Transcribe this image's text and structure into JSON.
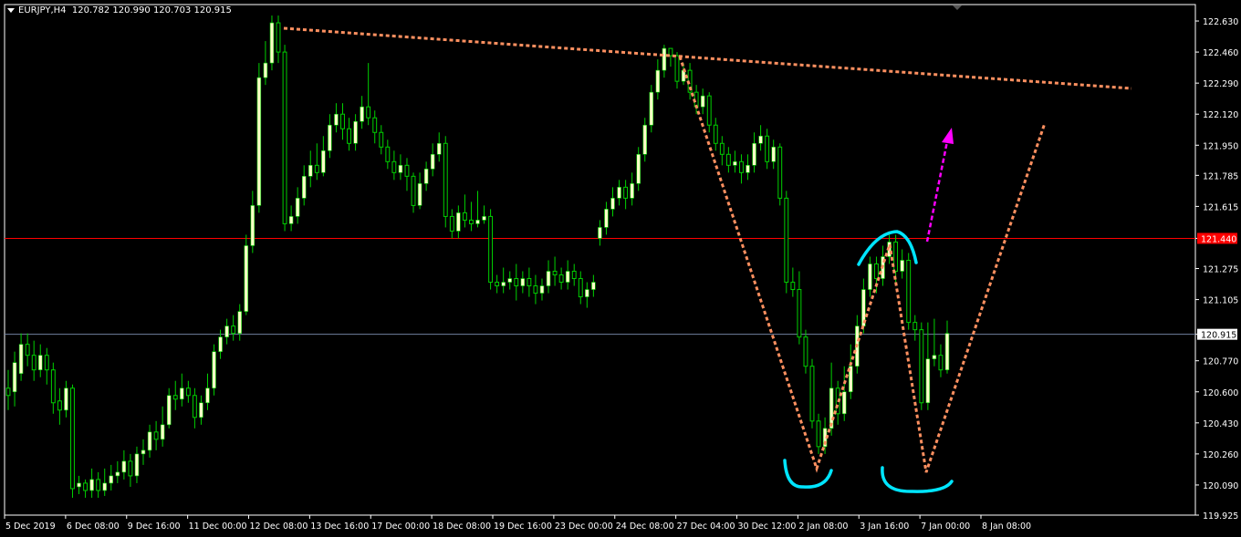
{
  "header": {
    "symbol": "EURJPY,H4",
    "ohlc": "120.782 120.990 120.703 120.915"
  },
  "colors": {
    "background": "#000000",
    "bull_candle": "#FFFFC8",
    "wick": "#00D000",
    "grid_frame": "#FFFFFF",
    "resistance_line": "#FF0000",
    "bid_line": "#7080A0",
    "pattern_lines": "#FF9060",
    "highlight_arcs": "#00E5FF",
    "arrow": "#FF00FF",
    "price_badge_bg": "#FF0000"
  },
  "chart_data": {
    "type": "candlestick",
    "symbol": "EURJPY",
    "timeframe": "H4",
    "ylim": [
      119.925,
      122.72
    ],
    "y_ticks": [
      122.63,
      122.46,
      122.29,
      122.12,
      121.95,
      121.785,
      121.615,
      121.44,
      121.275,
      121.105,
      120.915,
      120.77,
      120.6,
      120.43,
      120.26,
      120.09,
      119.925
    ],
    "x_ticks": [
      "5 Dec 2019",
      "6 Dec 08:00",
      "9 Dec 16:00",
      "11 Dec 00:00",
      "12 Dec 08:00",
      "13 Dec 16:00",
      "17 Dec 00:00",
      "18 Dec 08:00",
      "19 Dec 16:00",
      "23 Dec 00:00",
      "24 Dec 08:00",
      "27 Dec 04:00",
      "30 Dec 12:00",
      "2 Jan 08:00",
      "3 Jan 16:00",
      "7 Jan 00:00",
      "8 Jan 08:00"
    ],
    "resistance_level": 121.44,
    "current_price": 120.915,
    "candles": [
      [
        120.62,
        120.58,
        120.72,
        120.5
      ],
      [
        120.6,
        120.76,
        120.82,
        120.52
      ],
      [
        120.7,
        120.86,
        120.92,
        120.66
      ],
      [
        120.86,
        120.8,
        120.92,
        120.74
      ],
      [
        120.8,
        120.72,
        120.88,
        120.66
      ],
      [
        120.72,
        120.8,
        120.86,
        120.68
      ],
      [
        120.8,
        120.72,
        120.84,
        120.64
      ],
      [
        120.72,
        120.54,
        120.76,
        120.48
      ],
      [
        120.55,
        120.5,
        120.62,
        120.42
      ],
      [
        120.5,
        120.62,
        120.66,
        120.46
      ],
      [
        120.62,
        120.07,
        120.64,
        120.02
      ],
      [
        120.08,
        120.1,
        120.14,
        120.04
      ],
      [
        120.1,
        120.06,
        120.12,
        120.02
      ],
      [
        120.06,
        120.12,
        120.18,
        120.02
      ],
      [
        120.12,
        120.06,
        120.16,
        120.02
      ],
      [
        120.06,
        120.1,
        120.18,
        120.03
      ],
      [
        120.1,
        120.14,
        120.2,
        120.06
      ],
      [
        120.14,
        120.16,
        120.22,
        120.1
      ],
      [
        120.16,
        120.22,
        120.28,
        120.12
      ],
      [
        120.22,
        120.14,
        120.26,
        120.08
      ],
      [
        120.14,
        120.26,
        120.3,
        120.1
      ],
      [
        120.26,
        120.28,
        120.34,
        120.2
      ],
      [
        120.28,
        120.38,
        120.42,
        120.24
      ],
      [
        120.38,
        120.34,
        120.44,
        120.28
      ],
      [
        120.34,
        120.42,
        120.52,
        120.3
      ],
      [
        120.42,
        120.58,
        120.62,
        120.4
      ],
      [
        120.58,
        120.56,
        120.66,
        120.5
      ],
      [
        120.56,
        120.62,
        120.7,
        120.52
      ],
      [
        120.62,
        120.58,
        120.66,
        120.54
      ],
      [
        120.58,
        120.46,
        120.62,
        120.4
      ],
      [
        120.46,
        120.54,
        120.58,
        120.42
      ],
      [
        120.54,
        120.62,
        120.7,
        120.5
      ],
      [
        120.62,
        120.82,
        120.86,
        120.58
      ],
      [
        120.82,
        120.9,
        120.94,
        120.78
      ],
      [
        120.9,
        120.96,
        121.0,
        120.86
      ],
      [
        120.96,
        120.92,
        121.02,
        120.88
      ],
      [
        120.92,
        121.04,
        121.08,
        120.88
      ],
      [
        121.04,
        121.4,
        121.46,
        121.02
      ],
      [
        121.4,
        121.62,
        121.7,
        121.36
      ],
      [
        121.62,
        122.32,
        122.4,
        121.58
      ],
      [
        122.32,
        122.4,
        122.52,
        122.28
      ],
      [
        122.4,
        122.62,
        122.66,
        122.36
      ],
      [
        122.62,
        122.46,
        122.66,
        122.4
      ],
      [
        122.46,
        121.52,
        122.5,
        121.48
      ],
      [
        121.52,
        121.56,
        121.62,
        121.48
      ],
      [
        121.56,
        121.66,
        121.72,
        121.52
      ],
      [
        121.66,
        121.78,
        121.84,
        121.62
      ],
      [
        121.78,
        121.84,
        121.92,
        121.72
      ],
      [
        121.84,
        121.8,
        121.96,
        121.76
      ],
      [
        121.8,
        121.92,
        122.0,
        121.78
      ],
      [
        121.92,
        122.06,
        122.12,
        121.88
      ],
      [
        122.06,
        122.12,
        122.18,
        122.02
      ],
      [
        122.12,
        122.04,
        122.18,
        121.98
      ],
      [
        122.04,
        121.96,
        122.1,
        121.92
      ],
      [
        121.96,
        122.08,
        122.12,
        121.92
      ],
      [
        122.08,
        122.16,
        122.22,
        122.04
      ],
      [
        122.16,
        122.1,
        122.4,
        122.06
      ],
      [
        122.1,
        122.02,
        122.14,
        121.96
      ],
      [
        122.02,
        121.94,
        122.06,
        121.9
      ],
      [
        121.94,
        121.86,
        121.98,
        121.82
      ],
      [
        121.86,
        121.8,
        121.92,
        121.76
      ],
      [
        121.8,
        121.84,
        121.9,
        121.76
      ],
      [
        121.84,
        121.78,
        121.88,
        121.7
      ],
      [
        121.78,
        121.62,
        121.8,
        121.58
      ],
      [
        121.62,
        121.74,
        121.8,
        121.6
      ],
      [
        121.74,
        121.82,
        121.86,
        121.7
      ],
      [
        121.82,
        121.9,
        121.96,
        121.78
      ],
      [
        121.9,
        121.96,
        122.02,
        121.86
      ],
      [
        121.96,
        121.56,
        122.0,
        121.5
      ],
      [
        121.56,
        121.48,
        121.6,
        121.44
      ],
      [
        121.48,
        121.58,
        121.62,
        121.44
      ],
      [
        121.58,
        121.54,
        121.68,
        121.5
      ],
      [
        121.54,
        121.52,
        121.64,
        121.48
      ],
      [
        121.52,
        121.54,
        121.7,
        121.5
      ],
      [
        121.54,
        121.56,
        121.62,
        121.52
      ],
      [
        121.56,
        121.2,
        121.6,
        121.16
      ],
      [
        121.2,
        121.18,
        121.24,
        121.14
      ],
      [
        121.18,
        121.2,
        121.28,
        121.14
      ],
      [
        121.2,
        121.22,
        121.26,
        121.16
      ],
      [
        121.22,
        121.18,
        121.3,
        121.1
      ],
      [
        121.18,
        121.22,
        121.26,
        121.14
      ],
      [
        121.22,
        121.18,
        121.28,
        121.12
      ],
      [
        121.18,
        121.14,
        121.24,
        121.08
      ],
      [
        121.14,
        121.18,
        121.22,
        121.1
      ],
      [
        121.18,
        121.26,
        121.32,
        121.14
      ],
      [
        121.26,
        121.24,
        121.34,
        121.18
      ],
      [
        121.24,
        121.2,
        121.28,
        121.16
      ],
      [
        121.2,
        121.26,
        121.32,
        121.16
      ],
      [
        121.26,
        121.22,
        121.3,
        121.18
      ],
      [
        121.22,
        121.12,
        121.26,
        121.08
      ],
      [
        121.12,
        121.16,
        121.2,
        121.06
      ],
      [
        121.16,
        121.2,
        121.24,
        121.12
      ],
      [
        121.44,
        121.5,
        121.54,
        121.4
      ],
      [
        121.5,
        121.6,
        121.64,
        121.46
      ],
      [
        121.6,
        121.66,
        121.72,
        121.56
      ],
      [
        121.66,
        121.72,
        121.76,
        121.62
      ],
      [
        121.72,
        121.66,
        121.76,
        121.6
      ],
      [
        121.66,
        121.74,
        121.8,
        121.62
      ],
      [
        121.74,
        121.9,
        121.94,
        121.7
      ],
      [
        121.9,
        122.06,
        122.1,
        121.86
      ],
      [
        122.06,
        122.24,
        122.28,
        122.02
      ],
      [
        122.24,
        122.36,
        122.42,
        122.2
      ],
      [
        122.36,
        122.48,
        122.5,
        122.32
      ],
      [
        122.48,
        122.44,
        122.48,
        122.38
      ],
      [
        122.44,
        122.3,
        122.46,
        122.26
      ],
      [
        122.3,
        122.36,
        122.4,
        122.28
      ],
      [
        122.36,
        122.24,
        122.4,
        122.2
      ],
      [
        122.24,
        122.16,
        122.28,
        122.12
      ],
      [
        122.16,
        122.22,
        122.26,
        122.12
      ],
      [
        122.22,
        122.06,
        122.24,
        122.02
      ],
      [
        122.06,
        121.96,
        122.1,
        121.92
      ],
      [
        121.96,
        121.9,
        122.0,
        121.84
      ],
      [
        121.9,
        121.84,
        121.94,
        121.8
      ],
      [
        121.84,
        121.86,
        121.92,
        121.8
      ],
      [
        121.86,
        121.8,
        121.9,
        121.74
      ],
      [
        121.8,
        121.84,
        121.9,
        121.76
      ],
      [
        121.84,
        121.96,
        122.02,
        121.8
      ],
      [
        121.96,
        122.0,
        122.06,
        121.92
      ],
      [
        122.0,
        121.86,
        122.04,
        121.82
      ],
      [
        121.86,
        121.94,
        121.98,
        121.82
      ],
      [
        121.94,
        121.66,
        121.96,
        121.62
      ],
      [
        121.66,
        121.2,
        121.7,
        121.14
      ],
      [
        121.2,
        121.16,
        121.28,
        121.12
      ],
      [
        121.16,
        120.9,
        121.26,
        120.86
      ],
      [
        120.9,
        120.74,
        120.94,
        120.7
      ],
      [
        120.74,
        120.44,
        120.78,
        120.4
      ],
      [
        120.44,
        120.3,
        120.48,
        120.26
      ],
      [
        120.3,
        120.4,
        120.46,
        120.26
      ],
      [
        120.4,
        120.62,
        120.76,
        120.36
      ],
      [
        120.62,
        120.48,
        120.66,
        120.42
      ],
      [
        120.48,
        120.6,
        120.74,
        120.44
      ],
      [
        120.6,
        120.74,
        120.86,
        120.56
      ],
      [
        120.74,
        120.96,
        121.02,
        120.7
      ],
      [
        120.96,
        121.16,
        121.22,
        120.92
      ],
      [
        121.16,
        121.3,
        121.34,
        121.12
      ],
      [
        121.3,
        121.22,
        121.34,
        121.14
      ],
      [
        121.22,
        121.34,
        121.4,
        121.18
      ],
      [
        121.34,
        121.42,
        121.46,
        121.3
      ],
      [
        121.42,
        121.26,
        121.46,
        121.2
      ],
      [
        121.26,
        121.32,
        121.38,
        121.22
      ],
      [
        121.32,
        120.98,
        121.36,
        120.94
      ],
      [
        120.98,
        120.94,
        121.02,
        120.88
      ],
      [
        120.94,
        120.54,
        120.98,
        120.5
      ],
      [
        120.54,
        120.78,
        120.98,
        120.5
      ],
      [
        120.78,
        120.8,
        121.0,
        120.74
      ],
      [
        120.8,
        120.72,
        120.86,
        120.68
      ],
      [
        120.72,
        120.92,
        120.99,
        120.7
      ]
    ]
  }
}
